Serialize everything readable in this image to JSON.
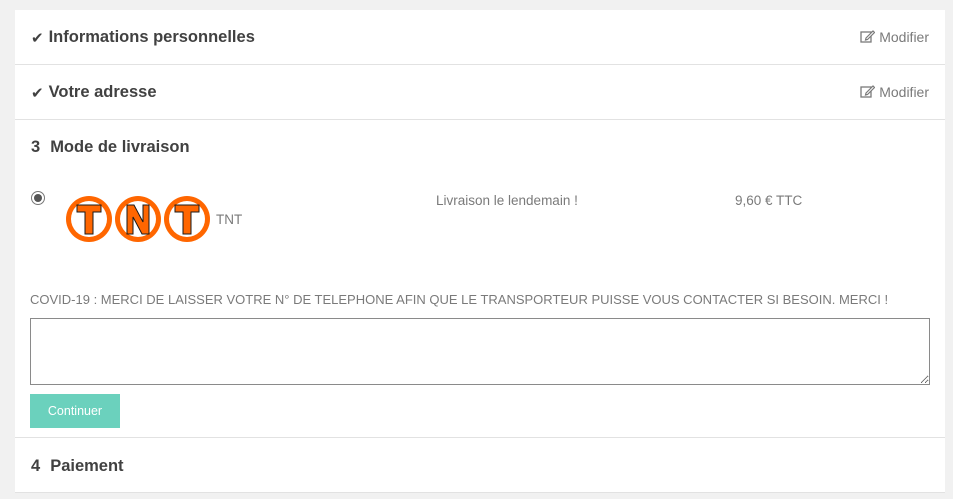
{
  "steps": [
    {
      "title": "Informations personnelles",
      "status": "done",
      "modify_label": "Modifier"
    },
    {
      "title": "Votre adresse",
      "status": "done",
      "modify_label": "Modifier"
    }
  ],
  "delivery": {
    "number": "3",
    "title": "Mode de livraison",
    "carrier": {
      "logo_text": "TNT",
      "name": "TNT",
      "delay": "Livraison le lendemain !",
      "price": "9,60 € TTC",
      "selected": true
    },
    "comment_label": "COVID-19 : MERCI DE LAISSER VOTRE N° DE TELEPHONE AFIN QUE LE TRANSPORTEUR PUISSE VOUS CONTACTER SI BESOIN. MERCI !",
    "comment_value": "",
    "continue_label": "Continuer"
  },
  "payment": {
    "number": "4",
    "title": "Paiement"
  },
  "colors": {
    "accent_button": "#6bd1bd",
    "tnt_orange": "#ff6600"
  }
}
